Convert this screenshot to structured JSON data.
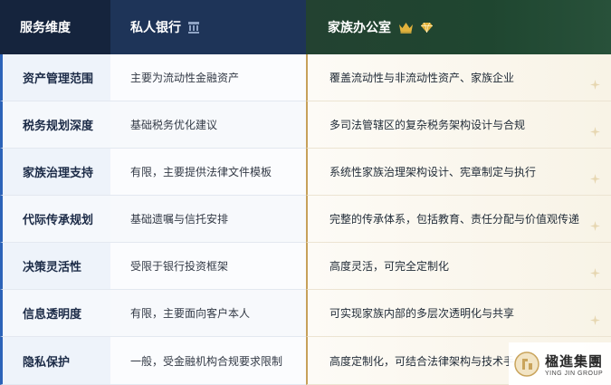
{
  "header": {
    "dimension": "服务维度",
    "private_bank": "私人银行",
    "family_office": "家族办公室"
  },
  "rows": [
    {
      "dimension": "资产管理范围",
      "private_bank": "主要为流动性金融资产",
      "family_office": "覆盖流动性与非流动性资产、家族企业"
    },
    {
      "dimension": "税务规划深度",
      "private_bank": "基础税务优化建议",
      "family_office": "多司法管辖区的复杂税务架构设计与合规"
    },
    {
      "dimension": "家族治理支持",
      "private_bank": "有限，主要提供法律文件模板",
      "family_office": "系统性家族治理架构设计、宪章制定与执行"
    },
    {
      "dimension": "代际传承规划",
      "private_bank": "基础遗嘱与信托安排",
      "family_office": "完整的传承体系，包括教育、责任分配与价值观传递"
    },
    {
      "dimension": "决策灵活性",
      "private_bank": "受限于银行投资框架",
      "family_office": "高度灵活，可完全定制化"
    },
    {
      "dimension": "信息透明度",
      "private_bank": "有限，主要面向客户本人",
      "family_office": "可实现家族内部的多层次透明化与共享"
    },
    {
      "dimension": "隐私保护",
      "private_bank": "一般，受金融机构合规要求限制",
      "family_office": "高度定制化，可结合法律架构与技术手"
    }
  ],
  "logo": {
    "name_cn": "楹進集團",
    "name_en": "YING JIN GROUP"
  },
  "colors": {
    "header_dark": "#15243d",
    "header_blue": "#1e3458",
    "header_green": "#234231",
    "gold": "#c7a15a",
    "accent_blue": "#2c63b8"
  },
  "icons": {
    "private_bank": "bank-icon",
    "family_office": [
      "crown-icon",
      "gem-icon"
    ],
    "row_decoration": "sparkle-icon"
  }
}
